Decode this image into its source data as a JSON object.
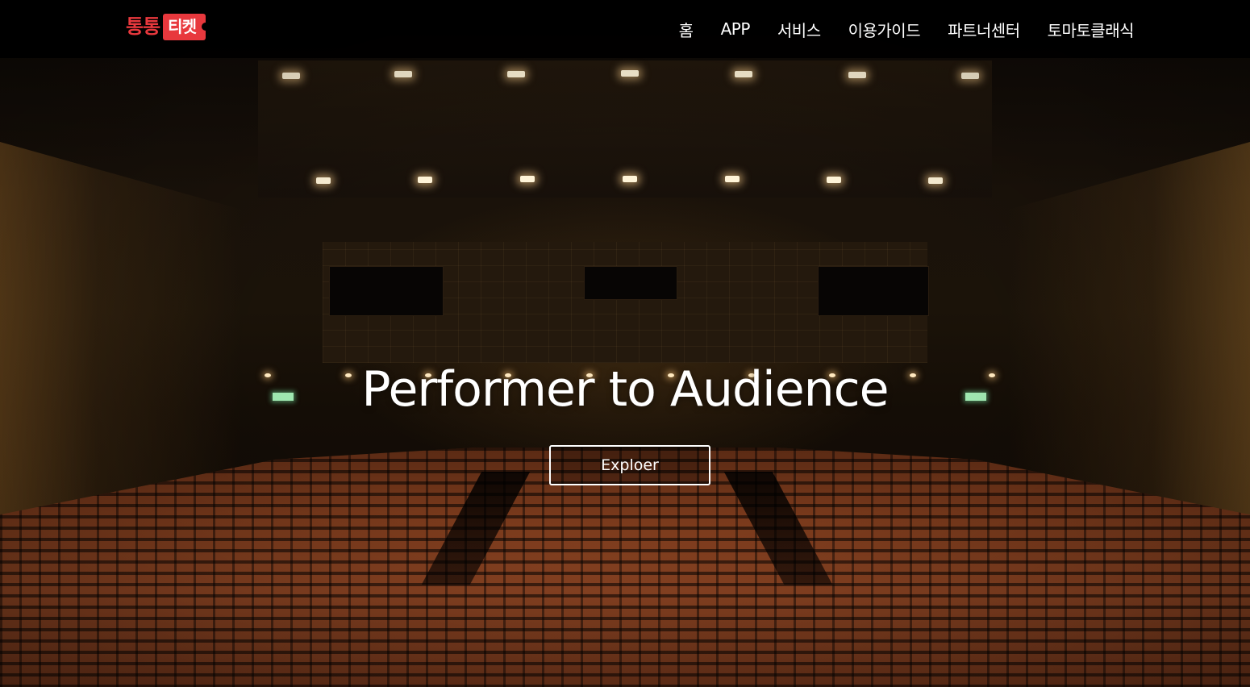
{
  "brand": {
    "logo_text": "통통",
    "logo_badge": "티켓",
    "logo_color": "#e8383d"
  },
  "nav": {
    "items": [
      {
        "label": "홈"
      },
      {
        "label": "APP"
      },
      {
        "label": "서비스"
      },
      {
        "label": "이용가이드"
      },
      {
        "label": "파트너센터"
      },
      {
        "label": "토마토클래식"
      }
    ]
  },
  "hero": {
    "title": "Performer to Audience",
    "button_label": "Exploer",
    "background": "theater-auditorium-image"
  },
  "colors": {
    "navbar_bg": "#000000",
    "text": "#ffffff",
    "accent": "#e8383d"
  }
}
